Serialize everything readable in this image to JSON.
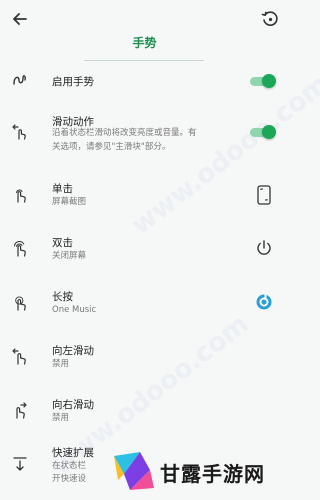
{
  "header": {
    "back_icon": "arrow-left-icon",
    "restore_icon": "history-restore-icon",
    "title": "手势"
  },
  "toggles": [
    {
      "title": "启用手势",
      "enabled": true,
      "icon": "squiggle-gesture-icon"
    },
    {
      "title": "滑动动作",
      "description_line1": "沿着状态栏滑动将改变亮度或音量。有",
      "description_line2": "关选项，请参见\"主滑块\"部分。",
      "enabled": true,
      "icon": "swipe-left-gesture-icon"
    }
  ],
  "gestures": [
    {
      "title": "单击",
      "value": "屏幕截图",
      "icon": "single-tap-icon",
      "action_icon": "screenshot-phone-icon"
    },
    {
      "title": "双击",
      "value": "关闭屏幕",
      "icon": "double-tap-icon",
      "action_icon": "power-icon"
    },
    {
      "title": "长按",
      "value": "One Music",
      "icon": "long-press-icon",
      "action_icon": "music-app-icon"
    },
    {
      "title": "向左滑动",
      "value": "禁用",
      "icon": "swipe-left-icon"
    },
    {
      "title": "向右滑动",
      "value": "禁用",
      "icon": "swipe-right-icon"
    },
    {
      "title": "快速扩展",
      "value_line1": "在状态栏",
      "value_line2": "开快速设",
      "icon": "pull-down-icon"
    }
  ],
  "colors": {
    "accent": "#1e8e4e",
    "toggle_on": "#1ca657",
    "music_icon": "#2a9fd6"
  },
  "branding": {
    "logo_text": "甘露手游网"
  },
  "watermark_text": "www.odooo.com"
}
